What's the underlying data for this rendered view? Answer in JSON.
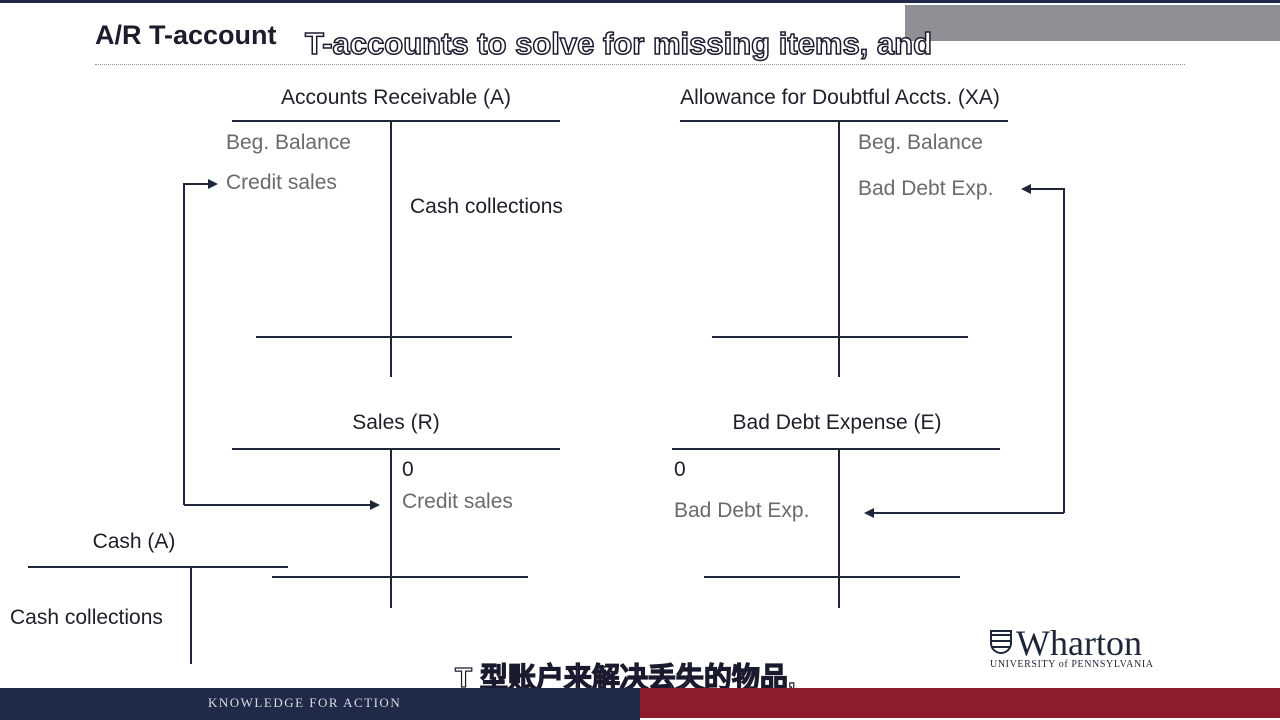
{
  "slide": {
    "title": "A/R T-account",
    "accounts": {
      "ar": {
        "title": "Accounts Receivable (A)",
        "debit": [
          "Beg. Balance",
          "Credit sales"
        ],
        "credit": [
          "Cash collections"
        ]
      },
      "xa": {
        "title": "Allowance for Doubtful Accts. (XA)",
        "credit": [
          "Beg. Balance",
          "Bad Debt Exp."
        ]
      },
      "sales": {
        "title": "Sales (R)",
        "credit": [
          "0",
          "Credit sales"
        ]
      },
      "bde": {
        "title": "Bad Debt Expense (E)",
        "debit": [
          "0",
          "Bad Debt Exp."
        ]
      },
      "cash": {
        "title": "Cash (A)",
        "debit": [
          "Cash collections"
        ]
      }
    }
  },
  "subtitles": {
    "english": "T-accounts to solve for missing items, and",
    "chinese": "T 型账户来解决丢失的物品,"
  },
  "branding": {
    "logo_name": "Wharton",
    "logo_sub": "UNIVERSITY of PENNSYLVANIA",
    "footer_tagline": "KNOWLEDGE FOR ACTION"
  },
  "colors": {
    "navy": "#1e2a48",
    "crimson": "#8e1c2e",
    "gray_box": "#8e9096"
  }
}
